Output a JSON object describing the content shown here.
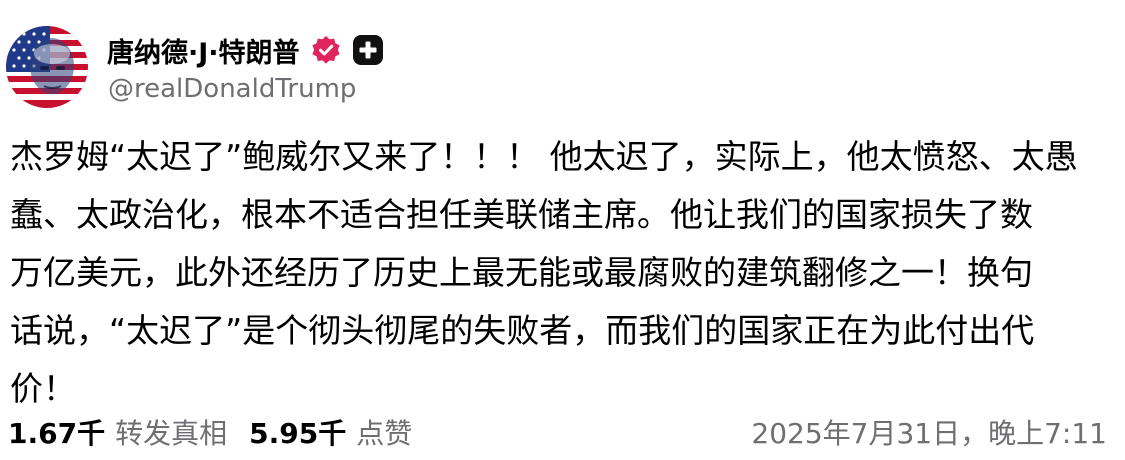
{
  "author": {
    "display_name": "唐纳德·J·特朗普",
    "handle": "@realDonaldTrump",
    "avatar_icon": "flag-portrait-avatar",
    "verified_icon": "verified-badge-icon",
    "verified_color": "#e0245e",
    "extra_badge_icon": "plus-badge-icon"
  },
  "post": {
    "lines": [
      "杰罗姆“太迟了”鲍威尔又来了！！！ 他太迟了，实际上，他太愤怒、太愚",
      "蠢、太政治化，根本不适合担任美联储主席。他让我们的国家损失了数",
      "万亿美元，此外还经历了历史上最无能或最腐败的建筑翻修之一！换句",
      "话说，“太迟了”是个彻头彻尾的失败者，而我们的国家正在为此付出代",
      "价！"
    ]
  },
  "stats": {
    "reposts_count": "1.67千",
    "reposts_label": "转发真相",
    "likes_count": "5.95千",
    "likes_label": "点赞"
  },
  "timestamp": "2025年7月31日，晚上7:11"
}
